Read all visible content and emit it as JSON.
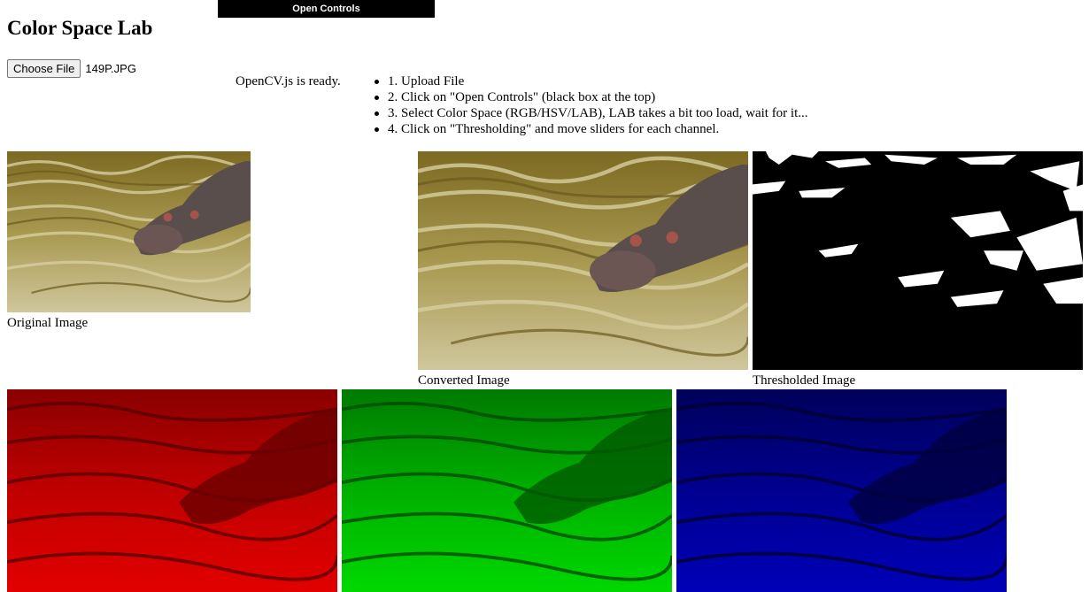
{
  "header": {
    "open_controls_label": "Open Controls",
    "title": "Color Space Lab"
  },
  "file_input": {
    "button_label": "Choose File",
    "file_name": "149P.JPG"
  },
  "status": "OpenCV.js is ready.",
  "instructions": [
    "1. Upload File",
    "2. Click on \"Open Controls\" (black box at the top)",
    "3. Select Color Space (RGB/HSV/LAB), LAB takes a bit too load, wait for it...",
    "4. Click on \"Thresholding\" and move sliders for each channel."
  ],
  "captions": {
    "original": "Original Image",
    "converted": "Converted Image",
    "thresholded": "Thresholded Image"
  },
  "colors": {
    "water_base": "#8a7a3a",
    "water_light": "#c9bf8e",
    "hippo": "#5a4a48",
    "red_channel": "#cc0000",
    "green_channel": "#00bb00",
    "blue_channel": "#0000cc"
  }
}
